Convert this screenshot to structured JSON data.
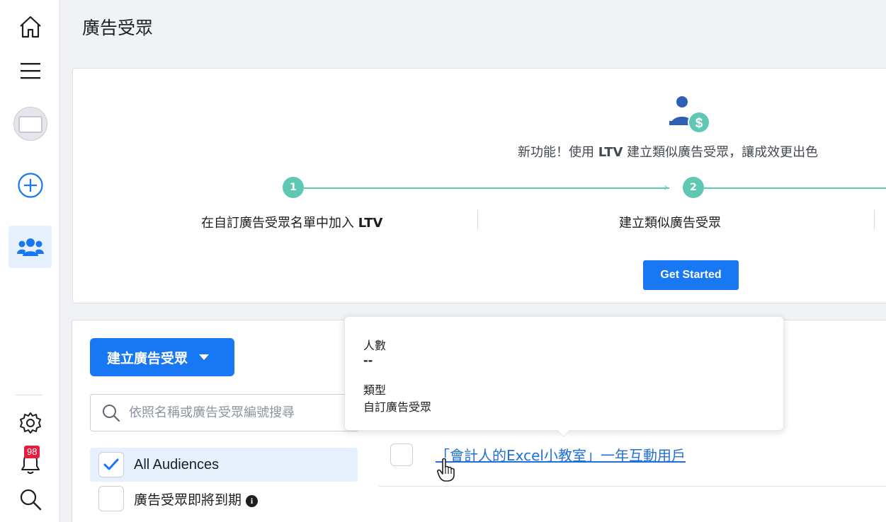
{
  "page": {
    "title": "廣告受眾"
  },
  "sidebar": {
    "notification_count": "98"
  },
  "ltv_promo": {
    "headline_pre": "新功能！使用 ",
    "headline_bold": "LTV",
    "headline_post": " 建立類似廣告受眾，讓成效更出色",
    "steps": [
      {
        "number": "1",
        "label_pre": "在自訂廣告受眾名單中加入 ",
        "label_bold": "LTV"
      },
      {
        "number": "2",
        "label_pre": "建立類似廣告受眾",
        "label_bold": ""
      }
    ],
    "cta_label": "Get Started"
  },
  "audiences": {
    "create_button_label": "建立廣告受眾",
    "search_placeholder": "依照名稱或廣告受眾編號搜尋",
    "filters": [
      {
        "label": "All Audiences",
        "checked": true
      },
      {
        "label": "廣告受眾即將到期",
        "checked": false
      }
    ],
    "rows": [
      {
        "name": "「會計人的Excel小教室」一年互動用戶"
      }
    ]
  },
  "tooltip": {
    "size_label": "人數",
    "size_value": "--",
    "type_label": "類型",
    "type_value": "自訂廣告受眾"
  },
  "colors": {
    "primary": "#1877f2",
    "step_accent": "#5ec8b2",
    "link": "#216fdb",
    "badge": "#e41e3f"
  }
}
